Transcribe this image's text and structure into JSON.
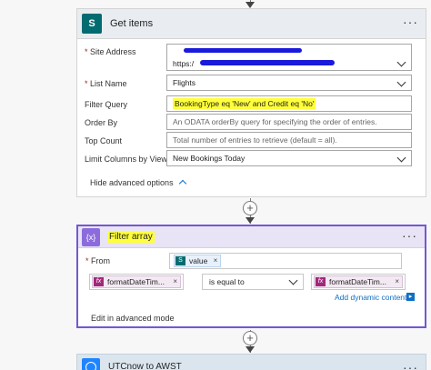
{
  "get_items": {
    "icon_text": "S",
    "title": "Get items",
    "menu_icon": "more-dots",
    "site_address_label": "Site Address",
    "site_address_prefix": "https:/",
    "list_name_label": "List Name",
    "list_name_value": "Flights",
    "filter_query_label": "Filter Query",
    "filter_query_value": "BookingType eq 'New' and Credit eq 'No'",
    "order_by_label": "Order By",
    "order_by_placeholder": "An ODATA orderBy query for specifying the order of entries.",
    "top_count_label": "Top Count",
    "top_count_placeholder": "Total number of entries to retrieve (default = all).",
    "limit_columns_label": "Limit Columns by View",
    "limit_columns_value": "New Bookings Today",
    "hide_advanced": "Hide advanced options",
    "required_mark": "*"
  },
  "filter_array": {
    "icon_text": "{x}",
    "title": "Filter array",
    "menu_icon": "more-dots",
    "from_label": "From",
    "from_token": "value",
    "left_token": "formatDateTim...",
    "operator": "is equal to",
    "right_token": "formatDateTim...",
    "token_icon": "fx",
    "remove_mark": "×",
    "add_dynamic": "Add dynamic content",
    "edit_advanced": "Edit in advanced mode",
    "required_mark": "*"
  },
  "utcnow": {
    "title": "UTCnow to AWST",
    "menu_icon": "more-dots"
  },
  "connectors": {
    "plus": "+"
  },
  "colors": {
    "sharepoint": "#036c70",
    "filter_accent": "#7557d1",
    "highlight": "#ffff3a",
    "redaction": "#1a1adc",
    "link": "#0f6fc6",
    "schedule": "#1f85ff"
  }
}
